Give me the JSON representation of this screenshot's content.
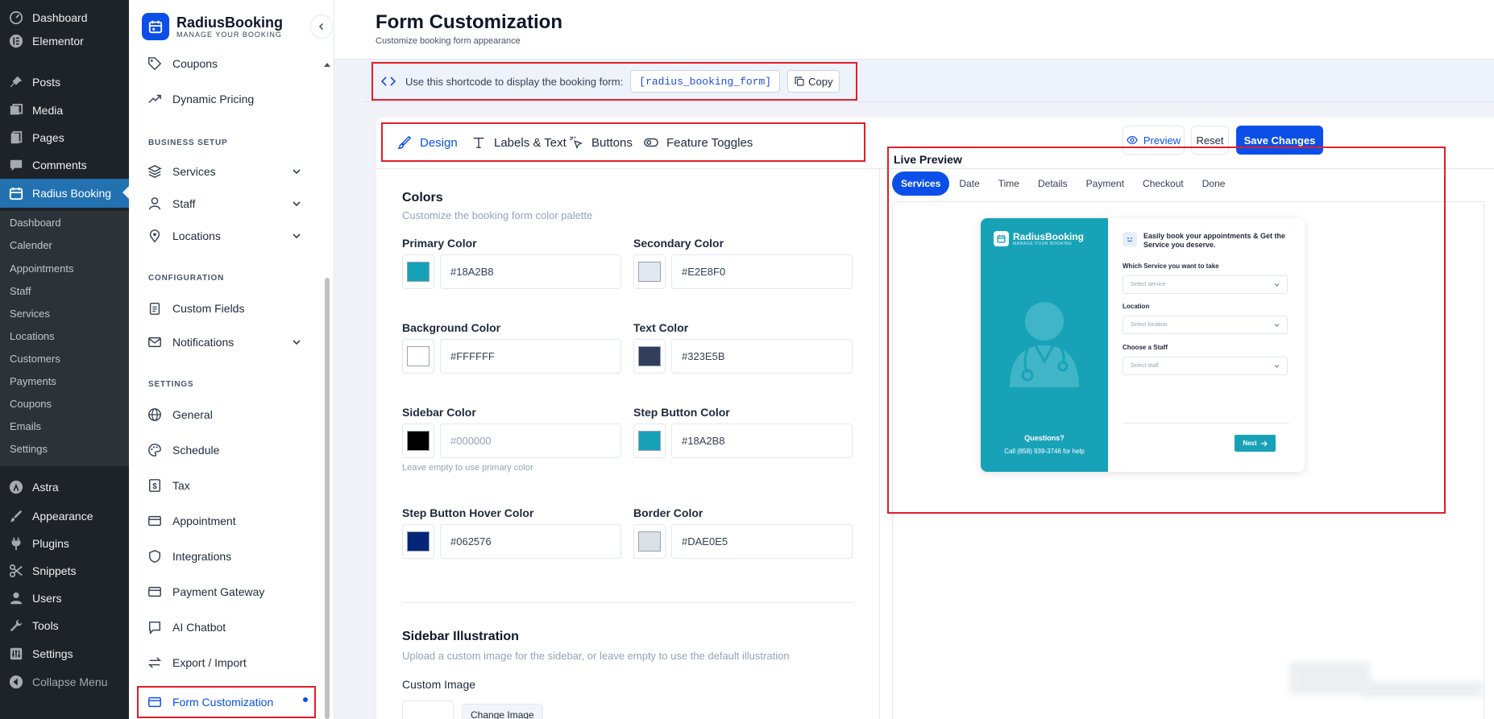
{
  "wp_menu": {
    "items": [
      {
        "label": "Dashboard",
        "icon": "gauge-icon"
      },
      {
        "label": "Elementor",
        "icon": "elementor-icon"
      },
      {
        "label": "Posts",
        "icon": "pin-icon"
      },
      {
        "label": "Media",
        "icon": "media-icon"
      },
      {
        "label": "Pages",
        "icon": "page-icon"
      },
      {
        "label": "Comments",
        "icon": "comment-icon"
      },
      {
        "label": "Radius Booking",
        "icon": "calendar-icon"
      },
      {
        "label": "Astra",
        "icon": "astra-icon"
      },
      {
        "label": "Appearance",
        "icon": "brush-icon"
      },
      {
        "label": "Plugins",
        "icon": "plug-icon"
      },
      {
        "label": "Snippets",
        "icon": "scissors-icon"
      },
      {
        "label": "Users",
        "icon": "user-icon"
      },
      {
        "label": "Tools",
        "icon": "wrench-icon"
      },
      {
        "label": "Settings",
        "icon": "sliders-icon"
      },
      {
        "label": "Collapse Menu",
        "icon": "collapse-icon"
      }
    ],
    "submenu": [
      "Dashboard",
      "Calender",
      "Appointments",
      "Staff",
      "Services",
      "Locations",
      "Customers",
      "Payments",
      "Coupons",
      "Emails",
      "Settings"
    ]
  },
  "plugin_sidebar": {
    "brand_name": "RadiusBooking",
    "brand_tagline": "MANAGE YOUR BOOKING",
    "items_top": [
      {
        "label": "Coupons",
        "icon": "tag-icon"
      },
      {
        "label": "Dynamic Pricing",
        "icon": "trend-icon"
      }
    ],
    "section_business": "BUSINESS SETUP",
    "items_business": [
      {
        "label": "Services",
        "icon": "layers-icon"
      },
      {
        "label": "Staff",
        "icon": "user-icon"
      },
      {
        "label": "Locations",
        "icon": "map-pin-icon"
      }
    ],
    "section_config": "CONFIGURATION",
    "items_config": [
      {
        "label": "Custom Fields",
        "icon": "clipboard-icon"
      },
      {
        "label": "Notifications",
        "icon": "mail-icon"
      }
    ],
    "section_settings": "SETTINGS",
    "items_settings": [
      {
        "label": "General",
        "icon": "globe-icon"
      },
      {
        "label": "Schedule",
        "icon": "palette-icon"
      },
      {
        "label": "Tax",
        "icon": "dollar-icon"
      },
      {
        "label": "Appointment",
        "icon": "card-icon"
      },
      {
        "label": "Integrations",
        "icon": "shield-icon"
      },
      {
        "label": "Payment Gateway",
        "icon": "card-icon"
      },
      {
        "label": "AI Chatbot",
        "icon": "chat-icon"
      },
      {
        "label": "Export / Import",
        "icon": "swap-icon"
      },
      {
        "label": "Form Customization",
        "icon": "card-icon"
      }
    ]
  },
  "header": {
    "title": "Form Customization",
    "subtitle": "Customize booking form appearance"
  },
  "shortcode": {
    "text": "Use this shortcode to display the booking form:",
    "code": "[radius_booking_form]",
    "copy_label": "Copy"
  },
  "tabs": [
    {
      "label": "Design",
      "icon": "brush-icon"
    },
    {
      "label": "Labels & Text",
      "icon": "text-icon"
    },
    {
      "label": "Buttons",
      "icon": "pointer-icon"
    },
    {
      "label": "Feature Toggles",
      "icon": "toggle-icon"
    }
  ],
  "actions": {
    "preview": "Preview",
    "reset": "Reset",
    "save": "Save Changes"
  },
  "colors": {
    "title": "Colors",
    "desc": "Customize the booking form color palette",
    "fields": [
      {
        "label": "Primary Color",
        "value": "#18A2B8",
        "swatch": "#18a2b8"
      },
      {
        "label": "Secondary Color",
        "value": "#E2E8F0",
        "swatch": "#e2e8f0"
      },
      {
        "label": "Background Color",
        "value": "#FFFFFF",
        "swatch": "#ffffff"
      },
      {
        "label": "Text Color",
        "value": "#323E5B",
        "swatch": "#323e5b"
      },
      {
        "label": "Sidebar Color",
        "placeholder": "#000000",
        "swatch": "#000000"
      },
      {
        "label": "Step Button Color",
        "value": "#18A2B8",
        "swatch": "#18a2b8"
      },
      {
        "label": "Step Button Hover Color",
        "value": "#062576",
        "swatch": "#062576"
      },
      {
        "label": "Border Color",
        "value": "#DAE0E5",
        "swatch": "#dae0e5"
      }
    ],
    "sidebar_hint": "Leave empty to use primary color"
  },
  "illustration": {
    "title": "Sidebar Illustration",
    "desc": "Upload a custom image for the sidebar, or leave empty to use the default illustration",
    "custom_image_label": "Custom Image",
    "change_image": "Change Image"
  },
  "live_preview": {
    "title": "Live Preview",
    "steps": [
      "Services",
      "Date",
      "Time",
      "Details",
      "Payment",
      "Checkout",
      "Done"
    ],
    "brand_name": "RadiusBooking",
    "brand_tagline": "MANAGE YOUR BOOKING",
    "heading": "Easily book your appointments & Get the Service you deserve.",
    "field1_label": "Which Service you want to take",
    "field1_placeholder": "Select service",
    "field2_label": "Location",
    "field2_placeholder": "Select location",
    "field3_label": "Choose a Staff",
    "field3_placeholder": "Select staff",
    "questions": "Questions?",
    "call": "Call (858) 939-3746 for help",
    "next": "Next"
  }
}
